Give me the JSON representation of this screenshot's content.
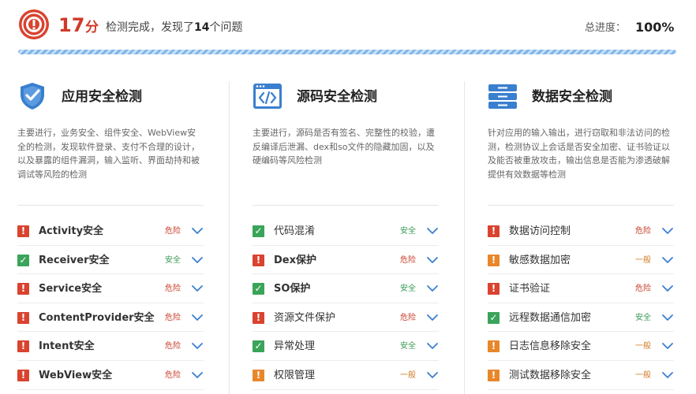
{
  "header": {
    "score": "17",
    "score_unit": "分",
    "summary_prefix": "检测完成，发现了",
    "issue_count": "14",
    "summary_suffix": "个问题",
    "progress_label": "总进度：",
    "progress_value": "100%",
    "progress_fraction": 1.0
  },
  "colors": {
    "danger": "#d9432f",
    "normal": "#e8862a",
    "safe": "#3aa45a",
    "accent": "#3a7fcf"
  },
  "columns": [
    {
      "icon": "shield-check-icon",
      "title": "应用安全检测",
      "desc": "主要进行，业务安全、组件安全、WebView安全的检测，发现软件登录、支付不合理的设计，以及暴露的组件漏洞，输入监听、界面劫持和被调试等风险的检测",
      "items": [
        {
          "name": "Activity安全",
          "status": "危险",
          "level": "danger"
        },
        {
          "name": "Receiver安全",
          "status": "安全",
          "level": "safe"
        },
        {
          "name": "Service安全",
          "status": "危险",
          "level": "danger"
        },
        {
          "name": "ContentProvider安全",
          "status": "危险",
          "level": "danger"
        },
        {
          "name": "Intent安全",
          "status": "危险",
          "level": "danger"
        },
        {
          "name": "WebView安全",
          "status": "危险",
          "level": "danger"
        }
      ]
    },
    {
      "icon": "code-icon",
      "title": "源码安全检测",
      "desc": "主要进行，源码是否有签名、完整性的校验，遭 反编译后泄漏、dex和so文件的隐藏加固，以及 硬编码等风险检测",
      "items": [
        {
          "name": "代码混淆",
          "status": "安全",
          "level": "safe"
        },
        {
          "name": "Dex保护",
          "status": "危险",
          "level": "danger"
        },
        {
          "name": "SO保护",
          "status": "安全",
          "level": "safe"
        },
        {
          "name": "资源文件保护",
          "status": "危险",
          "level": "danger"
        },
        {
          "name": "异常处理",
          "status": "安全",
          "level": "safe"
        },
        {
          "name": "权限管理",
          "status": "一般",
          "level": "normal"
        }
      ]
    },
    {
      "icon": "database-icon",
      "title": "数据安全检测",
      "desc": "针对应用的输入输出，进行窃取和非法访问的检测，检测协议上会话是否安全加密、证书验证以及能否被重放攻击，输出信息是否能为渗透破解提供有效数据等检测",
      "items": [
        {
          "name": "数据访问控制",
          "status": "危险",
          "level": "danger"
        },
        {
          "name": "敏感数据加密",
          "status": "一般",
          "level": "normal"
        },
        {
          "name": "证书验证",
          "status": "危险",
          "level": "danger"
        },
        {
          "name": "远程数据通信加密",
          "status": "安全",
          "level": "safe"
        },
        {
          "name": "日志信息移除安全",
          "status": "一般",
          "level": "normal"
        },
        {
          "name": "测试数据移除安全",
          "status": "一般",
          "level": "normal"
        }
      ]
    }
  ]
}
